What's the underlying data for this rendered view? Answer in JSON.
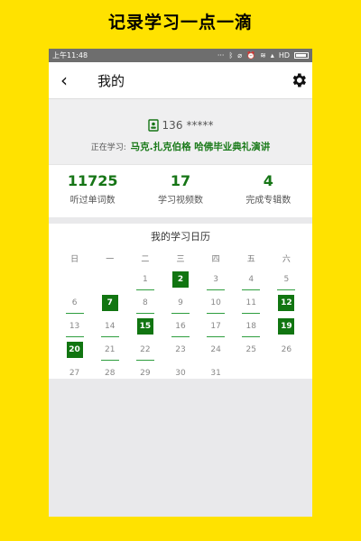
{
  "banner": {
    "text": "记录学习一点一滴"
  },
  "statusbar": {
    "time": "上午11:48",
    "icons": [
      "dots-icon",
      "bluetooth-icon",
      "mute-icon",
      "alarm-icon",
      "wifi-icon",
      "signal-icon"
    ],
    "network": "HD"
  },
  "topbar": {
    "back_icon": "chevron-left-icon",
    "title": "我的",
    "settings_icon": "gear-icon"
  },
  "profile": {
    "phone": "136",
    "phone_masked": "*****",
    "studying_label": "正在学习:",
    "course": "马克.扎克伯格 哈佛毕业典礼演讲"
  },
  "stats": [
    {
      "value": "11725",
      "label": "听过单词数"
    },
    {
      "value": "17",
      "label": "学习视频数"
    },
    {
      "value": "4",
      "label": "完成专辑数"
    }
  ],
  "calendar": {
    "title": "我的学习日历",
    "weekdays": [
      "日",
      "一",
      "二",
      "三",
      "四",
      "五",
      "六"
    ],
    "weeks": [
      [
        "",
        "",
        "1",
        "2",
        "3",
        "4",
        "5"
      ],
      [
        "6",
        "7",
        "8",
        "9",
        "10",
        "11",
        "12"
      ],
      [
        "13",
        "14",
        "15",
        "16",
        "17",
        "18",
        "19"
      ],
      [
        "20",
        "21",
        "22",
        "23",
        "24",
        "25",
        "26"
      ],
      [
        "27",
        "28",
        "29",
        "30",
        "31",
        "",
        ""
      ]
    ],
    "studied_days": [
      "2",
      "7",
      "12",
      "15",
      "19",
      "20"
    ],
    "underlined_days": [
      "1",
      "3",
      "4",
      "5",
      "6",
      "8",
      "9",
      "10",
      "11",
      "13",
      "14",
      "16",
      "17",
      "18",
      "21",
      "22"
    ],
    "accent_color": "#117511"
  }
}
